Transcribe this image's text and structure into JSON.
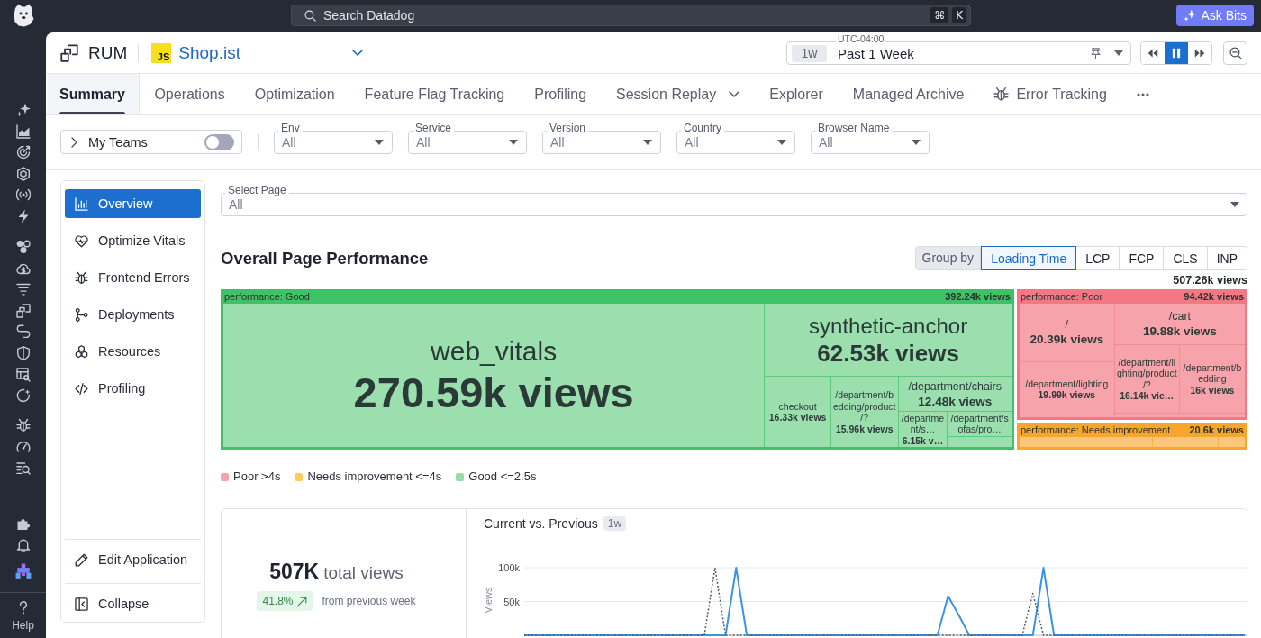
{
  "topbar": {
    "search": {
      "placeholder": "Search Datadog",
      "shortcut": [
        "⌘",
        "K"
      ]
    },
    "ask_button": "Ask Bits"
  },
  "nav": {
    "help": "Help"
  },
  "header": {
    "product": "RUM",
    "app_badge": "JS",
    "app_name": "Shop.ist",
    "time": {
      "timezone": "UTC-04:00",
      "chip": "1w",
      "value": "Past 1 Week"
    },
    "playback": {
      "live": true
    }
  },
  "tabs": [
    {
      "label": "Summary",
      "selected": true,
      "kind": "text"
    },
    {
      "label": "Operations",
      "selected": false,
      "kind": "text"
    },
    {
      "label": "Optimization",
      "selected": false,
      "kind": "text"
    },
    {
      "label": "Feature Flag Tracking",
      "selected": false,
      "kind": "text"
    },
    {
      "label": "Profiling",
      "selected": false,
      "kind": "text"
    },
    {
      "label": "Session Replay",
      "selected": false,
      "kind": "menu"
    },
    {
      "label": "Explorer",
      "selected": false,
      "kind": "text"
    },
    {
      "label": "Managed Archive",
      "selected": false,
      "kind": "text"
    },
    {
      "label": "Error Tracking",
      "selected": false,
      "kind": "icon"
    }
  ],
  "filters": {
    "my_teams": {
      "label": "My Teams",
      "on": false
    },
    "dropdowns": [
      {
        "label": "Env",
        "value": "All"
      },
      {
        "label": "Service",
        "value": "All"
      },
      {
        "label": "Version",
        "value": "All"
      },
      {
        "label": "Country",
        "value": "All"
      },
      {
        "label": "Browser Name",
        "value": "All"
      }
    ]
  },
  "side_panel": {
    "items": [
      {
        "label": "Overview",
        "selected": true
      },
      {
        "label": "Optimize Vitals",
        "selected": false
      },
      {
        "label": "Frontend Errors",
        "selected": false
      },
      {
        "label": "Deployments",
        "selected": false
      },
      {
        "label": "Resources",
        "selected": false
      },
      {
        "label": "Profiling",
        "selected": false
      }
    ],
    "footer": [
      "Edit Application",
      "Collapse"
    ]
  },
  "select_page": {
    "label": "Select Page",
    "value": "All"
  },
  "performance": {
    "title": "Overall Page Performance",
    "group_by": {
      "label": "Group by",
      "options": [
        {
          "label": "Loading Time",
          "selected": true
        },
        {
          "label": "LCP",
          "selected": false
        },
        {
          "label": "FCP",
          "selected": false
        },
        {
          "label": "CLS",
          "selected": false
        },
        {
          "label": "INP",
          "selected": false
        }
      ]
    },
    "total": "507.26k views",
    "groups": [
      {
        "label": "performance: Good",
        "views": "392.24k views",
        "color": "#3fc165",
        "tiles": [
          {
            "name": "web_vitals",
            "views": "270.59k views"
          },
          {
            "name": "synthetic-anchor",
            "views": "62.53k views"
          },
          {
            "name": "checkout",
            "views": "16.33k views"
          },
          {
            "name": "/department/bedding/product/?",
            "views": "15.96k views"
          },
          {
            "name": "/department/chairs",
            "views": "12.48k views"
          },
          {
            "name": "/department/s…",
            "views": "6.15k v…"
          },
          {
            "name": "/department/sofas/pro…"
          }
        ]
      },
      {
        "label": "performance: Poor",
        "views": "94.42k views",
        "color": "#f27884",
        "tiles": [
          {
            "name": "/",
            "views": "20.39k views"
          },
          {
            "name": "/department/lighting",
            "views": "19.99k views"
          },
          {
            "name": "/cart",
            "views": "19.88k views"
          },
          {
            "name": "/department/lighting/product/?",
            "views": "16.14k vie…"
          },
          {
            "name": "/department/bedding",
            "views": "16k views"
          }
        ]
      },
      {
        "label": "performance: Needs improvement",
        "views": "20.6k views",
        "color": "#f8a52a"
      }
    ],
    "legend": [
      {
        "label": "Poor >4s",
        "color": "#f5a3ab"
      },
      {
        "label": "Needs improvement <=4s",
        "color": "#fdcd5f"
      },
      {
        "label": "Good <=2.5s",
        "color": "#98dca5"
      }
    ]
  },
  "summary_card": {
    "value": "507K",
    "unit": "total views",
    "change": "41.8%",
    "comparison": "from previous week",
    "chart": {
      "title": "Current vs. Previous",
      "chip": "1w",
      "chart_data": {
        "type": "line",
        "ylabel": "Views",
        "ylim": [
          0,
          100000
        ],
        "yticks": [
          {
            "value": 50000,
            "label": "50k"
          },
          {
            "value": 100000,
            "label": "100k"
          }
        ],
        "series": [
          {
            "color": "#3b93e6",
            "line_style": "solid",
            "values": [
              0,
              0,
              0,
              0,
              0,
              0,
              0,
              0,
              0,
              0,
              0,
              0,
              0,
              0,
              0,
              0,
              0,
              0,
              0,
              0,
              100000,
              0,
              0,
              0,
              0,
              0,
              0,
              0,
              0,
              0,
              0,
              0,
              0,
              0,
              0,
              0,
              0,
              0,
              0,
              0,
              58000,
              30000,
              0,
              0,
              0,
              0,
              0,
              0,
              0,
              100000,
              0,
              0,
              0,
              0,
              0,
              0,
              0,
              0,
              0,
              0,
              0,
              0,
              0,
              0,
              0,
              0,
              0,
              0,
              0
            ]
          },
          {
            "color": "#555a66",
            "line_style": "dotted",
            "values": [
              0,
              0,
              0,
              0,
              0,
              0,
              0,
              0,
              0,
              0,
              0,
              0,
              0,
              0,
              0,
              0,
              0,
              0,
              100000,
              0,
              0,
              0,
              0,
              0,
              0,
              0,
              0,
              0,
              0,
              0,
              0,
              0,
              0,
              0,
              0,
              0,
              0,
              0,
              0,
              0,
              0,
              0,
              0,
              0,
              0,
              0,
              0,
              0,
              62000,
              0,
              0,
              0,
              0,
              0,
              0,
              0,
              0,
              0,
              0,
              0,
              0,
              0,
              0,
              0,
              0,
              0,
              0,
              0,
              0
            ]
          }
        ]
      }
    }
  }
}
